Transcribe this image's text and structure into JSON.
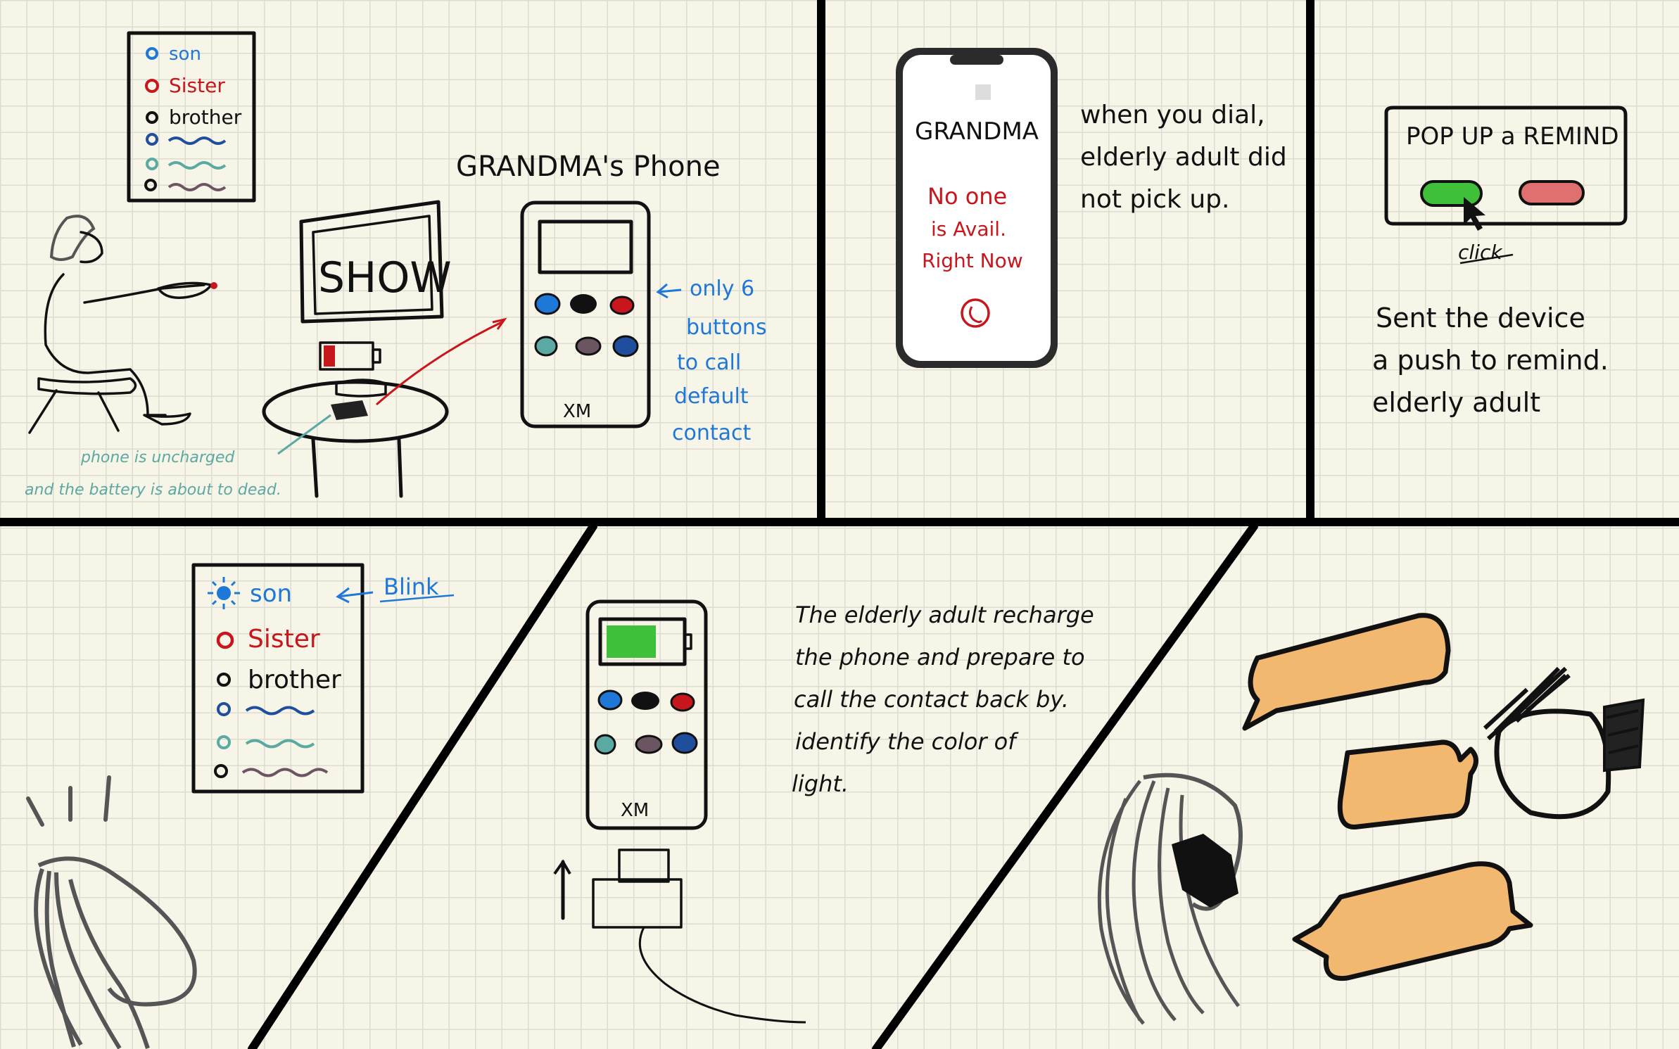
{
  "panel1": {
    "contacts": [
      "son",
      "Sister",
      "brother"
    ],
    "tv_label": "SHOW",
    "phone_title": "GRANDMA's Phone",
    "phone_brand": "XM",
    "buttons_note": [
      "only 6",
      "buttons",
      "to call",
      "default",
      "contact"
    ],
    "battery_note": [
      "phone is uncharged",
      "and the battery is about to dead."
    ]
  },
  "panel2": {
    "screen_name": "GRANDMA",
    "screen_message": [
      "No one",
      "is Avail.",
      "Right Now"
    ],
    "note": [
      "when you dial,",
      "elderly adult did",
      "not pick up."
    ]
  },
  "panel3": {
    "popup_title": "POP UP a REMIND",
    "click_label": "click",
    "note": [
      "Sent the device",
      "a push to remind.",
      "elderly adult"
    ]
  },
  "panel4": {
    "contacts": [
      "son",
      "Sister",
      "brother"
    ],
    "blink_label": "Blink"
  },
  "panel5": {
    "phone_brand": "XM",
    "note": [
      "The elderly adult recharge",
      "the phone and prepare to",
      "call the contact back by.",
      "identify the color of",
      "light."
    ]
  },
  "colors": {
    "frame": "#000000",
    "paper": "#f7f4e8",
    "grid": "#dedbd0",
    "blue": "#1e78d8",
    "red": "#c8161d",
    "teal": "#5aa9a3",
    "green": "#3fbf3a",
    "orange": "#f3b870"
  }
}
